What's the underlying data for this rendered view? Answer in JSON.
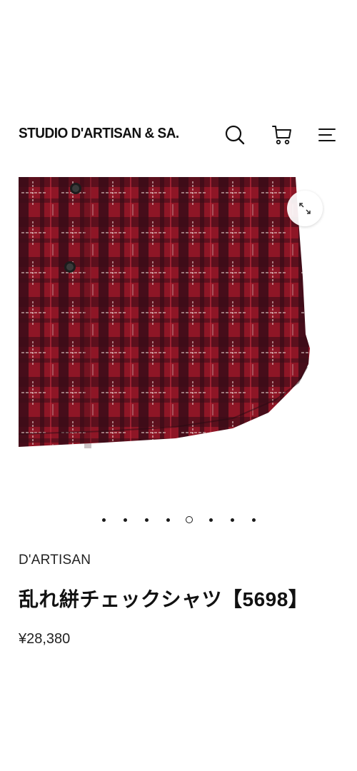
{
  "header": {
    "logo_text": "STUDIO D'ARTISAN & SA.",
    "search_icon": "search-icon",
    "cart_icon": "cart-icon",
    "menu_icon": "menu-icon"
  },
  "gallery": {
    "zoom_icon": "expand-icon",
    "slide_count": 8,
    "active_slide_index": 4,
    "colors": {
      "fabric_red": "#8e1626",
      "fabric_dark": "#2a0a12",
      "stitch": "#e8d8d4"
    }
  },
  "product": {
    "brand": "D'ARTISAN",
    "title": "乱れ絣チェックシャツ【5698】",
    "price": "¥28,380"
  }
}
